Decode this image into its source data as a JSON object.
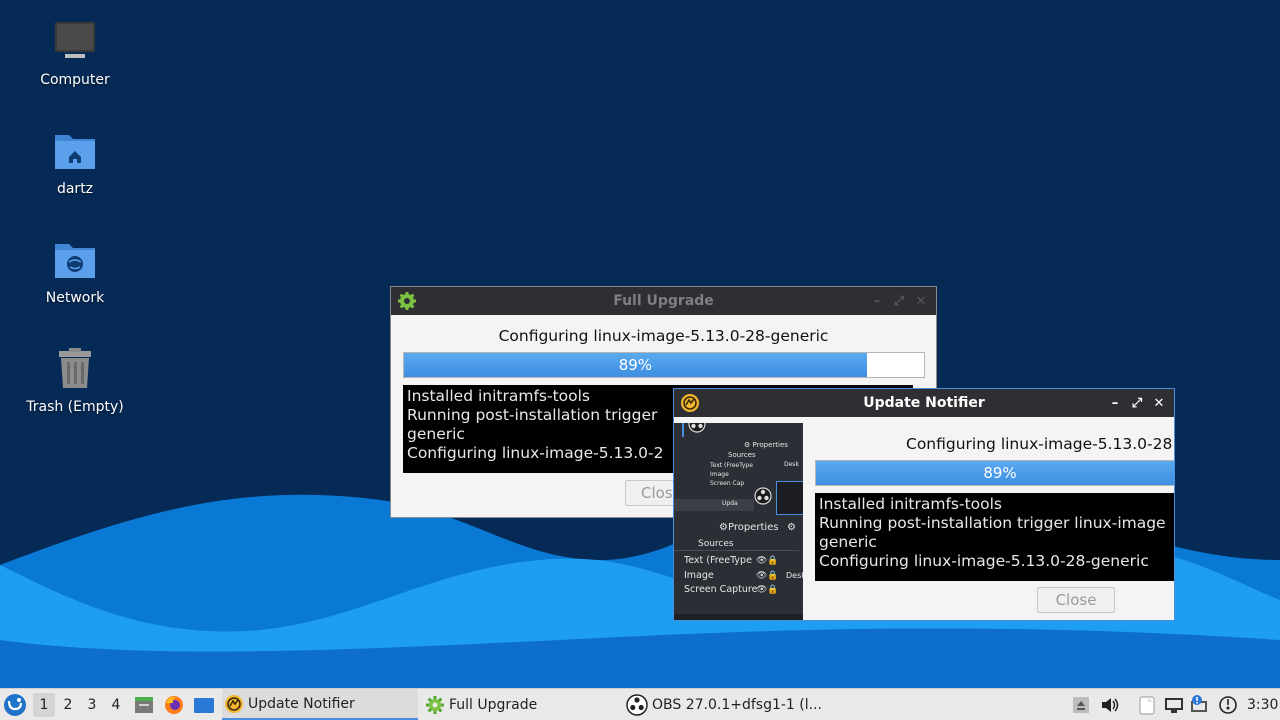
{
  "desktop": {
    "icons": [
      {
        "label": "Computer",
        "icon": "computer-icon"
      },
      {
        "label": "dartz",
        "icon": "home-folder-icon"
      },
      {
        "label": "Network",
        "icon": "network-folder-icon"
      },
      {
        "label": "Trash (Empty)",
        "icon": "trash-icon"
      }
    ]
  },
  "full_upgrade": {
    "title": "Full Upgrade",
    "status": "Configuring linux-image-5.13.0-28-generic",
    "progress_percent": 89,
    "progress_label": "89%",
    "log": [
      "Installed initramfs-tools",
      "Running post-installation trigger",
      "generic",
      "Configuring linux-image-5.13.0-2"
    ],
    "close_label": "Clos"
  },
  "update_notifier": {
    "title": "Update Notifier",
    "status": "Configuring linux-image-5.13.0-28",
    "progress_percent": 89,
    "progress_label": "89%",
    "log": [
      "Installed initramfs-tools",
      "Running post-installation trigger linux-image",
      "generic",
      "Configuring linux-image-5.13.0-28-generic"
    ],
    "close_label": "Close"
  },
  "obs_snapshot": {
    "properties_label": "Properties",
    "sources_label": "Sources",
    "sources": [
      "Text (FreeType",
      "Image",
      "Screen Capture"
    ],
    "mini_sources": [
      "Text (FreeType",
      "Image",
      "Screen Cap"
    ],
    "mini_properties": "Properties",
    "mini_sources_label": "Sources",
    "desk_label": "Desk",
    "mini_desk": "Desk",
    "mini_upd": "Upda"
  },
  "taskbar": {
    "workspaces": [
      "1",
      "2",
      "3",
      "4"
    ],
    "active_workspace": "1",
    "tasks": [
      {
        "label": "Update Notifier",
        "icon": "update-notifier-icon"
      },
      {
        "label": "Full Upgrade",
        "icon": "gear-icon"
      },
      {
        "label": "OBS 27.0.1+dfsg1-1 (l...",
        "icon": "obs-icon"
      }
    ],
    "clock": "3:30"
  }
}
